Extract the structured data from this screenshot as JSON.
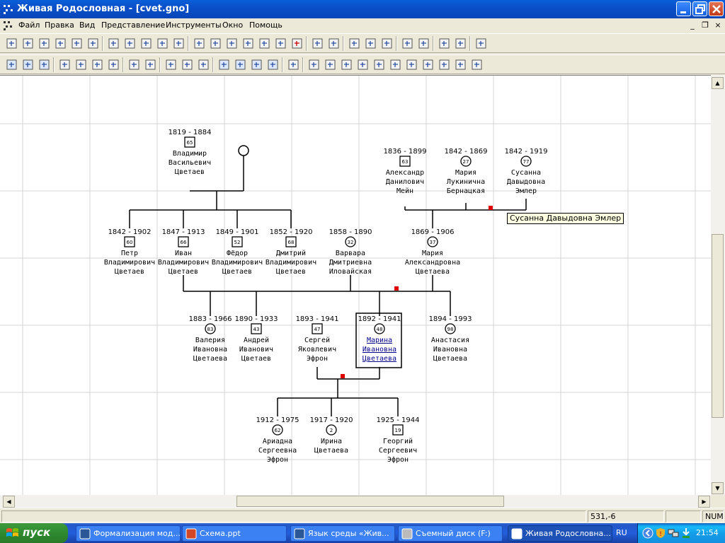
{
  "window": {
    "title": "Живая Родословная - [cvet.gno]"
  },
  "menu": [
    "Файл",
    "Правка",
    "Вид",
    "Представление",
    "Инструменты",
    "Окно",
    "Помощь"
  ],
  "toolbar1": [
    "new-icon",
    "open-icon",
    "save-icon",
    "print-preview-icon",
    "preview-icon",
    "print-icon",
    "cut-icon",
    "copy-icon",
    "paste-icon",
    "undo-icon",
    "redo-icon",
    "add-person-icon",
    "add-person2-icon",
    "edit-icon",
    "add-parents-icon",
    "add-children-icon",
    "add-spouse-icon",
    "delete-icon",
    "tools-icon",
    "magic-icon",
    "gedcom-icon",
    "ged-html-icon",
    "export-icon",
    "font-icon",
    "font-small-icon",
    "layout-icon",
    "grid-icon",
    "help-icon"
  ],
  "toolbar2": [
    "gen1-icon",
    "gen2-icon",
    "gen3-icon",
    "tool-a-icon",
    "tool-b-icon",
    "tool-c-icon",
    "tool-d-icon",
    "back-icon",
    "forward-icon",
    "document-icon",
    "binoculars-icon",
    "find-person-icon",
    "zoom-in-icon",
    "zoom-out-icon",
    "zoom-fit-icon",
    "zoom-page-icon",
    "refresh-icon",
    "layout-tree-icon",
    "tree-1-icon",
    "tree-2-icon",
    "tree-3-icon",
    "tree-4-icon",
    "tree-5-icon",
    "tree-6-icon",
    "tree-7-icon",
    "tree-8-icon",
    "tree-9-icon",
    "tree-10-icon"
  ],
  "tree": {
    "people": [
      {
        "id": "vladimir",
        "years": "1819 - 1884",
        "age": "65",
        "name": [
          "Владимир",
          "Васильевич",
          "Цветаев"
        ],
        "sex": "m"
      },
      {
        "id": "aleksandr",
        "years": "1836 - 1899",
        "age": "63",
        "name": [
          "Александр",
          "Данилович",
          "Мейн"
        ],
        "sex": "m"
      },
      {
        "id": "maria-b",
        "years": "1842 - 1869",
        "age": "27",
        "name": [
          "Мария",
          "Лукинична",
          "Бернацкая"
        ],
        "sex": "f"
      },
      {
        "id": "susanna",
        "years": "1842 - 1919",
        "age": "77",
        "name": [
          "Сусанна",
          "Давыдовна",
          "Эмлер"
        ],
        "sex": "f"
      },
      {
        "id": "petr",
        "years": "1842 - 1902",
        "age": "60",
        "name": [
          "Петр",
          "Владимирович",
          "Цветаев"
        ],
        "sex": "m"
      },
      {
        "id": "ivan",
        "years": "1847 - 1913",
        "age": "66",
        "name": [
          "Иван",
          "Владимирович",
          "Цветаев"
        ],
        "sex": "m"
      },
      {
        "id": "fedor",
        "years": "1849 - 1901",
        "age": "52",
        "name": [
          "Фёдор",
          "Владимирович",
          "Цветаев"
        ],
        "sex": "m"
      },
      {
        "id": "dmitriy",
        "years": "1852 - 1920",
        "age": "68",
        "name": [
          "Дмитрий",
          "Владимирович",
          "Цветаев"
        ],
        "sex": "m"
      },
      {
        "id": "varvara",
        "years": "1858 - 1890",
        "age": "32",
        "name": [
          "Варвара",
          "Дмитриевна",
          "Иловайская"
        ],
        "sex": "f"
      },
      {
        "id": "maria-m",
        "years": "1869 - 1906",
        "age": "37",
        "name": [
          "Мария",
          "Александровна",
          "Цветаева"
        ],
        "sex": "f"
      },
      {
        "id": "valeria",
        "years": "1883 - 1966",
        "age": "83",
        "name": [
          "Валерия",
          "Ивановна",
          "Цветаева"
        ],
        "sex": "f"
      },
      {
        "id": "andrey",
        "years": "1890 - 1933",
        "age": "43",
        "name": [
          "Андрей",
          "Иванович",
          "Цветаев"
        ],
        "sex": "m"
      },
      {
        "id": "sergey",
        "years": "1893 - 1941",
        "age": "47",
        "name": [
          "Сергей",
          "Яковлевич",
          "Эфрон"
        ],
        "sex": "m"
      },
      {
        "id": "marina",
        "years": "1892 - 1941",
        "age": "48",
        "name": [
          "Марина",
          "Ивановна",
          "Цветаева"
        ],
        "sex": "f"
      },
      {
        "id": "anastasia",
        "years": "1894 - 1993",
        "age": "98",
        "name": [
          "Анастасия",
          "Ивановна",
          "Цветаева"
        ],
        "sex": "f"
      },
      {
        "id": "ariadna",
        "years": "1912 - 1975",
        "age": "62",
        "name": [
          "Ариадна",
          "Сергеевна",
          "Эфрон"
        ],
        "sex": "f"
      },
      {
        "id": "irina",
        "years": "1917 - 1920",
        "age": "2",
        "name": [
          "Ирина",
          "Цветаева"
        ],
        "sex": "f"
      },
      {
        "id": "georgiy",
        "years": "1925 - 1944",
        "age": "19",
        "name": [
          "Георгий",
          "Сергеевич",
          "Эфрон"
        ],
        "sex": "m"
      }
    ],
    "tooltip": "Сусанна Давыдовна Эмлер",
    "selected": "marina"
  },
  "status": {
    "coords": "531,-6",
    "num": "NUM"
  },
  "taskbar": {
    "start": "пуск",
    "tasks": [
      {
        "label": "Формализация мод...",
        "icon": "word-icon",
        "active": false
      },
      {
        "label": "Схема.ppt",
        "icon": "powerpoint-icon",
        "active": false
      },
      {
        "label": "Язык среды «Жив...",
        "icon": "word-icon",
        "active": false
      },
      {
        "label": "Съемный диск (F:)",
        "icon": "drive-icon",
        "active": false
      },
      {
        "label": "Живая Родословна...",
        "icon": "app-icon",
        "active": true
      }
    ],
    "lang": "RU",
    "clock": "21:54"
  }
}
